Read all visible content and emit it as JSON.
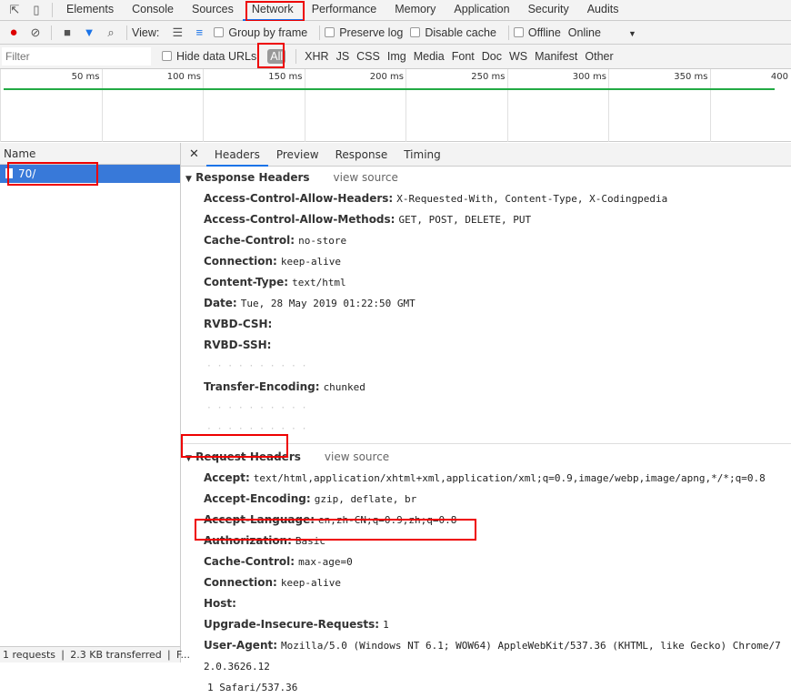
{
  "tabs": [
    "Elements",
    "Console",
    "Sources",
    "Network",
    "Performance",
    "Memory",
    "Application",
    "Security",
    "Audits"
  ],
  "toolbar": {
    "view_label": "View:",
    "group_by_frame": "Group by frame",
    "preserve_log": "Preserve log",
    "disable_cache": "Disable cache",
    "offline": "Offline",
    "throttle": "Online"
  },
  "filters": {
    "placeholder": "Filter",
    "hide_data_urls": "Hide data URLs",
    "types": [
      "All",
      "XHR",
      "JS",
      "CSS",
      "Img",
      "Media",
      "Font",
      "Doc",
      "WS",
      "Manifest",
      "Other"
    ]
  },
  "timeline": {
    "ticks": [
      "50 ms",
      "100 ms",
      "150 ms",
      "200 ms",
      "250 ms",
      "300 ms",
      "350 ms",
      "400"
    ]
  },
  "requests": {
    "header": "Name",
    "items": [
      "70/"
    ]
  },
  "status": "1 requests  ❘  2.3 KB transferred  ❘  F...",
  "detail_tabs": [
    "Headers",
    "Preview",
    "Response",
    "Timing"
  ],
  "response": {
    "title": "Response Headers",
    "view_source": "view source",
    "headers": [
      {
        "k": "Access-Control-Allow-Headers:",
        "v": "X-Requested-With, Content-Type, X-Codingpedia"
      },
      {
        "k": "Access-Control-Allow-Methods:",
        "v": "GET, POST, DELETE, PUT"
      },
      {
        "k": "Cache-Control:",
        "v": "no-store"
      },
      {
        "k": "Connection:",
        "v": "keep-alive"
      },
      {
        "k": "Content-Type:",
        "v": "text/html"
      },
      {
        "k": "Date:",
        "v": "Tue, 28 May 2019 01:22:50 GMT"
      },
      {
        "k": "RVBD-CSH:",
        "v": ""
      },
      {
        "k": "RVBD-SSH:",
        "v": ""
      },
      {
        "k": "",
        "v": ""
      },
      {
        "k": "Transfer-Encoding:",
        "v": "chunked"
      },
      {
        "k": "",
        "v": ""
      },
      {
        "k": "",
        "v": ""
      }
    ]
  },
  "request": {
    "title": "Request Headers",
    "view_source": "view source",
    "headers": [
      {
        "k": "Accept:",
        "v": "text/html,application/xhtml+xml,application/xml;q=0.9,image/webp,image/apng,*/*;q=0.8"
      },
      {
        "k": "Accept-Encoding:",
        "v": "gzip, deflate, br"
      },
      {
        "k": "Accept-Language:",
        "v": "en,zh-CN;q=0.9,zh;q=0.8"
      },
      {
        "k": "Authorization:",
        "v": "Basic"
      },
      {
        "k": "Cache-Control:",
        "v": "max-age=0"
      },
      {
        "k": "Connection:",
        "v": "keep-alive"
      },
      {
        "k": "Host:",
        "v": ""
      },
      {
        "k": "Upgrade-Insecure-Requests:",
        "v": "1"
      },
      {
        "k": "User-Agent:",
        "v": "Mozilla/5.0 (Windows NT 6.1; WOW64) AppleWebKit/537.36 (KHTML, like Gecko) Chrome/72.0.3626.12"
      },
      {
        "k": "",
        "v": "1 Safari/537.36"
      }
    ]
  },
  "colors": {
    "accent": "#1a73e8",
    "selected_row": "#3879d9",
    "highlight": "#e00000",
    "waterfall": "#22aa44"
  }
}
